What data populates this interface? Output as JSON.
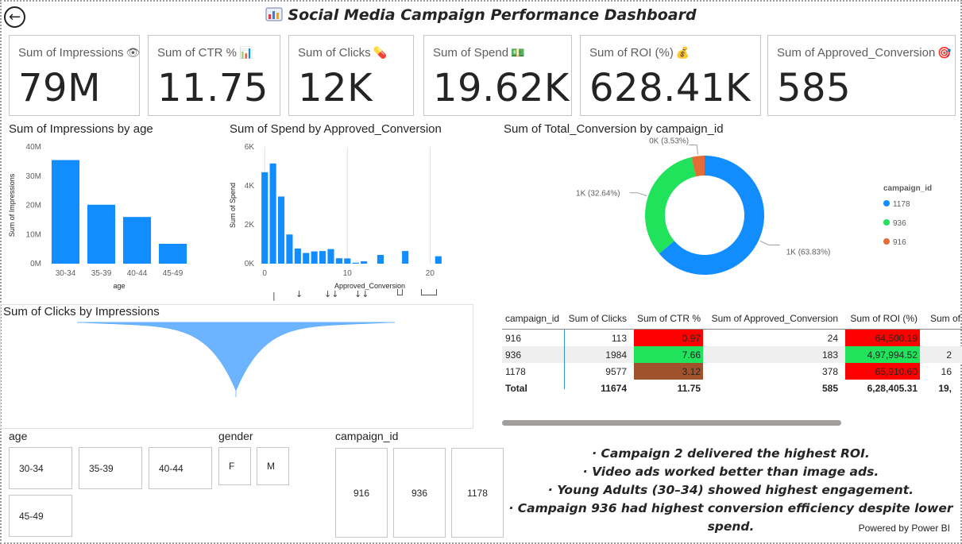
{
  "header": {
    "title": "Social Media Campaign Performance Dashboard",
    "back_icon": "back-arrow-icon",
    "title_icon": "bar-chart-icon"
  },
  "cards": [
    {
      "label": "Sum of Impressions",
      "value": "79M",
      "icon": "eye-icon",
      "glyph": "👁"
    },
    {
      "label": "Sum of CTR %",
      "value": "11.75",
      "icon": "chart-icon",
      "glyph": "📊"
    },
    {
      "label": "Sum of Clicks",
      "value": "12K",
      "icon": "pill-icon",
      "glyph": "💊"
    },
    {
      "label": "Sum of Spend",
      "value": "19.62K",
      "icon": "money-icon",
      "glyph": "💵"
    },
    {
      "label": "Sum of ROI (%)",
      "value": "628.41K",
      "icon": "money-bag-icon",
      "glyph": "💰"
    },
    {
      "label": "Sum of Approved_Conversion",
      "value": "585",
      "icon": "target-icon",
      "glyph": "🎯"
    }
  ],
  "colors": {
    "accent": "#118DFF",
    "series_1178": "#118DFF",
    "series_936": "#21E35B",
    "series_916": "#E36C37",
    "cell_red": "#FF0000",
    "cell_green": "#21E35B",
    "cell_brown": "#A0522D"
  },
  "chart_data": [
    {
      "id": "impressions-by-age",
      "type": "bar",
      "title": "Sum of Impressions by age",
      "xlabel": "age",
      "ylabel": "Sum of Impressions",
      "categories": [
        "30-34",
        "35-39",
        "40-44",
        "45-49"
      ],
      "values": [
        35.5,
        20.2,
        16.0,
        6.8
      ],
      "unit": "M",
      "ylim": [
        0,
        40
      ],
      "yticks": [
        "0M",
        "10M",
        "20M",
        "30M",
        "40M"
      ]
    },
    {
      "id": "spend-by-approved-conversion",
      "type": "bar",
      "title": "Sum of Spend by Approved_Conversion",
      "xlabel": "Approved_Conversion",
      "ylabel": "Sum of Spend",
      "x": [
        0,
        1,
        2,
        3,
        4,
        5,
        6,
        7,
        8,
        9,
        10,
        11,
        12,
        14,
        17,
        21
      ],
      "values": [
        4.7,
        5.15,
        3.45,
        1.5,
        0.78,
        0.55,
        0.63,
        0.65,
        0.75,
        0.28,
        0.27,
        0.05,
        0.12,
        0.45,
        0.65,
        0.38
      ],
      "unit": "K",
      "xlim": [
        -0.5,
        24
      ],
      "ylim": [
        0,
        6
      ],
      "yticks": [
        "0K",
        "2K",
        "4K",
        "6K"
      ],
      "xticks": [
        "0",
        "10",
        "20"
      ]
    },
    {
      "id": "total-conversion-by-campaign",
      "type": "pie",
      "title": "Sum of Total_Conversion by campaign_id",
      "legend_title": "campaign_id",
      "legend_position": "right",
      "slices": [
        {
          "label": "1178",
          "percent": 63.83,
          "display": "1K (63.83%)"
        },
        {
          "label": "936",
          "percent": 32.64,
          "display": "1K (32.64%)"
        },
        {
          "label": "916",
          "percent": 3.53,
          "display": "0K (3.53%)"
        }
      ]
    },
    {
      "id": "clicks-by-impressions",
      "type": "area",
      "title": "Sum of Clicks by Impressions"
    }
  ],
  "drill_controls": [
    "↓",
    "↓↓",
    "↓↓"
  ],
  "table": {
    "columns": [
      "campaign_id",
      "Sum of Clicks",
      "Sum of CTR %",
      "Sum of Approved_Conversion",
      "Sum of ROI (%)",
      "Sum of"
    ],
    "rows": [
      {
        "campaign_id": "916",
        "clicks": "113",
        "ctr": "0.97",
        "approved": "24",
        "roi": "64,500.19",
        "extra": ""
      },
      {
        "campaign_id": "936",
        "clicks": "1984",
        "ctr": "7.66",
        "approved": "183",
        "roi": "4,97,994.52",
        "extra": "2"
      },
      {
        "campaign_id": "1178",
        "clicks": "9577",
        "ctr": "3.12",
        "approved": "378",
        "roi": "65,910.60",
        "extra": "16"
      }
    ],
    "total": {
      "label": "Total",
      "clicks": "11674",
      "ctr": "11.75",
      "approved": "585",
      "roi": "6,28,405.31",
      "extra": "19,"
    }
  },
  "slicers": {
    "age": {
      "title": "age",
      "options": [
        "30-34",
        "35-39",
        "40-44",
        "45-49"
      ]
    },
    "gender": {
      "title": "gender",
      "options": [
        "F",
        "M"
      ]
    },
    "campaign": {
      "title": "campaign_id",
      "options": [
        "916",
        "936",
        "1178"
      ]
    }
  },
  "insights": [
    "· Campaign 2 delivered the highest ROI.",
    "· Video ads worked better than image ads.",
    "· Young Adults (30–34) showed highest engagement.",
    "· Campaign 936 had highest conversion efficiency despite lower spend."
  ],
  "footer": {
    "powered_by": "Powered by Power BI"
  }
}
